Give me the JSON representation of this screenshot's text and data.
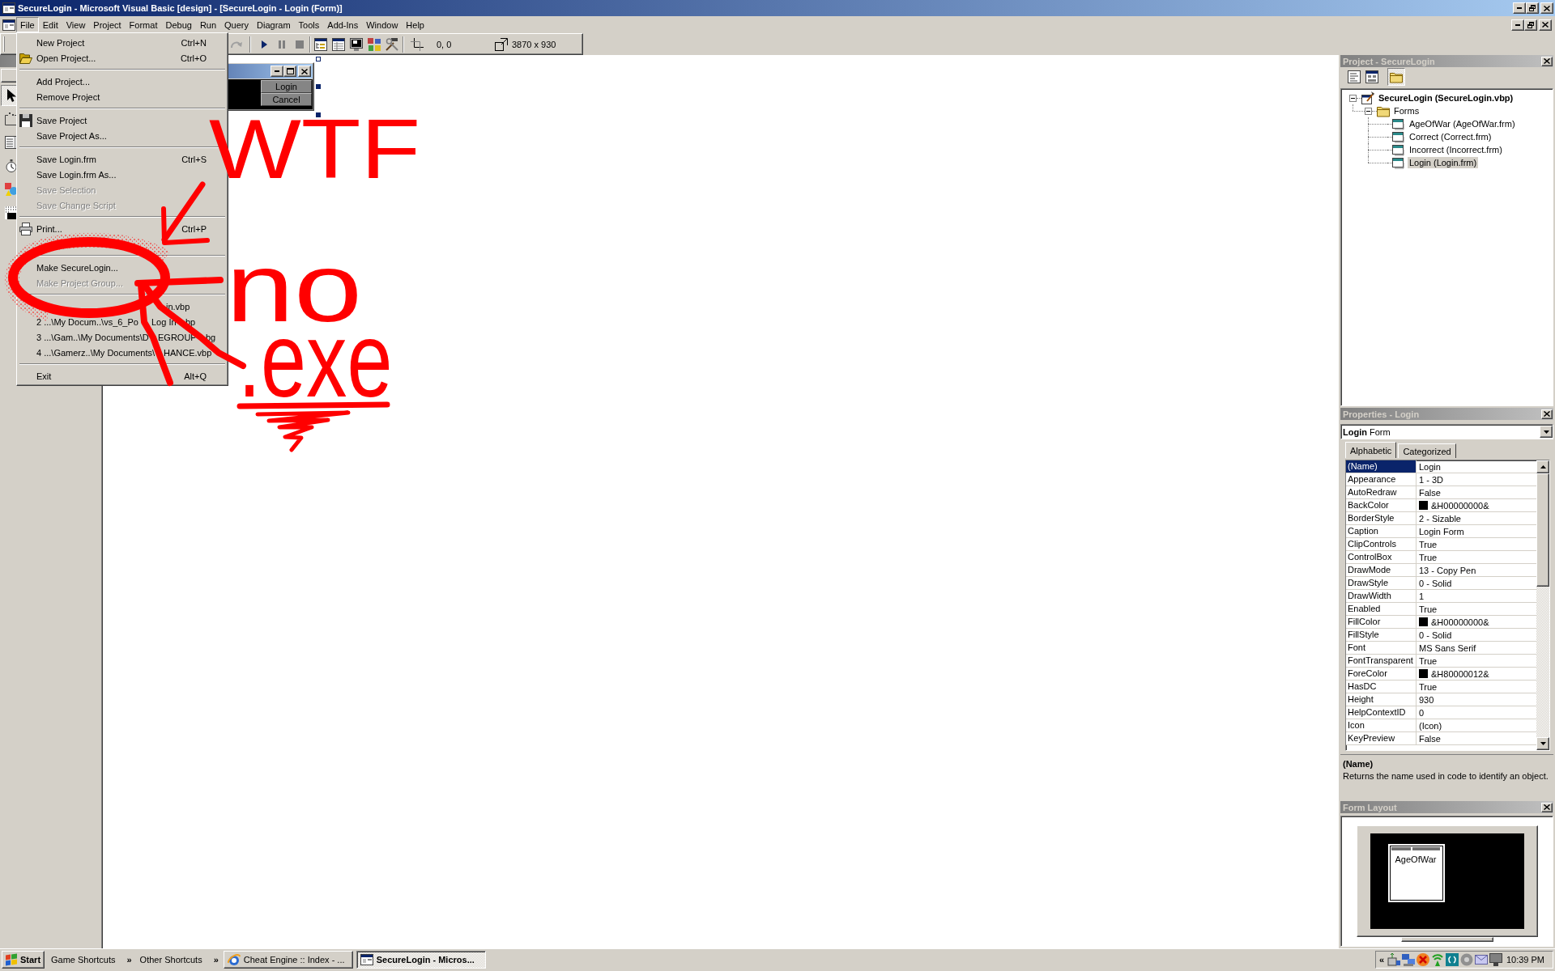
{
  "window": {
    "title": "SecureLogin - Microsoft Visual Basic [design] - [SecureLogin - Login (Form)]"
  },
  "menu_bar": [
    {
      "label": "File",
      "selected": true
    },
    {
      "label": "Edit",
      "selected": false
    },
    {
      "label": "View",
      "selected": false
    },
    {
      "label": "Project",
      "selected": false
    },
    {
      "label": "Format",
      "selected": false
    },
    {
      "label": "Debug",
      "selected": false
    },
    {
      "label": "Run",
      "selected": false
    },
    {
      "label": "Query",
      "selected": false
    },
    {
      "label": "Diagram",
      "selected": false
    },
    {
      "label": "Tools",
      "selected": false
    },
    {
      "label": "Add-Ins",
      "selected": false
    },
    {
      "label": "Window",
      "selected": false
    },
    {
      "label": "Help",
      "selected": false
    }
  ],
  "file_menu": [
    [
      {
        "kind": "command",
        "label": "New Project",
        "shortcut": "Ctrl+N",
        "disabled": false
      },
      {
        "kind": "command",
        "label": "Open Project...",
        "shortcut": "Ctrl+O",
        "icon": true,
        "disabled": false
      }
    ],
    [
      {
        "kind": "command",
        "label": "Add Project...",
        "disabled": false
      },
      {
        "kind": "command",
        "label": "Remove Project",
        "disabled": false
      }
    ],
    [
      {
        "kind": "command",
        "label": "Save Project",
        "icon": true,
        "disabled": false
      },
      {
        "kind": "command",
        "label": "Save Project As...",
        "disabled": false
      }
    ],
    [
      {
        "kind": "command",
        "label": "Save Login.frm",
        "shortcut": "Ctrl+S",
        "disabled": false
      },
      {
        "kind": "command",
        "label": "Save Login.frm As...",
        "disabled": false
      },
      {
        "kind": "command",
        "label": "Save Selection",
        "disabled": true
      },
      {
        "kind": "command",
        "label": "Save Change Script",
        "disabled": true
      }
    ],
    [
      {
        "kind": "command",
        "label": "Print...",
        "shortcut": "Ctrl+P",
        "icon": true,
        "disabled": false
      },
      {
        "kind": "covered"
      }
    ],
    [
      {
        "kind": "command",
        "label": "Make SecureLogin...",
        "disabled": false
      },
      {
        "kind": "command",
        "label": "Make Project Group...",
        "disabled": true
      }
    ],
    [
      {
        "kind": "recent",
        "fragments": [
          "in.vbp"
        ],
        "disabled": false
      },
      {
        "kind": "recent",
        "fragments": [
          "2 ...\\My Docum..\\vs_6_Po",
          "Log In",
          "bp"
        ],
        "disabled": false
      },
      {
        "kind": "recent",
        "fragments": [
          "3 ...\\Gam..\\My Documents\\D",
          "EGROUP",
          "bg"
        ],
        "disabled": false
      },
      {
        "kind": "recent",
        "fragments": [
          "4 ...\\Gamerz..\\My Documents\\",
          "HANCE.vbp"
        ],
        "disabled": false
      }
    ],
    [
      {
        "kind": "command",
        "label": "Exit",
        "shortcut": "Alt+Q",
        "disabled": false
      }
    ]
  ],
  "toolbar": {
    "position": "0, 0",
    "size": "3870 x 930"
  },
  "toolbox": [
    {
      "selected": true
    },
    {
      "selected": false
    },
    {
      "selected": false
    },
    {
      "selected": false
    },
    {
      "selected": false
    },
    {
      "selected": false
    }
  ],
  "designer": {
    "form_buttons": [
      "Login",
      "Cancel"
    ]
  },
  "project": {
    "title": "Project - SecureLogin",
    "toolbar": [
      {
        "on": false
      },
      {
        "on": false
      },
      {
        "on": true
      }
    ],
    "tree": [
      {
        "label": "SecureLogin (SecureLogin.vbp)",
        "selected": false,
        "expanded": true,
        "children": [
          {
            "label": "Forms",
            "selected": false,
            "expanded": true,
            "children": [
              {
                "label": "AgeOfWar (AgeOfWar.frm)",
                "selected": false
              },
              {
                "label": "Correct (Correct.frm)",
                "selected": false
              },
              {
                "label": "Incorrect (Incorrect.frm)",
                "selected": false
              },
              {
                "label": "Login (Login.frm)",
                "selected": true
              }
            ]
          }
        ]
      }
    ]
  },
  "properties": {
    "title": "Properties - Login",
    "object": "**Login** Form",
    "tabs": [
      {
        "label": "Alphabetic",
        "selected": true
      },
      {
        "label": "Categorized",
        "selected": false
      }
    ],
    "rows": [
      {
        "name": "(Name)",
        "value": "Login",
        "selected": true
      },
      {
        "name": "Appearance",
        "value": "1 - 3D",
        "selected": false
      },
      {
        "name": "AutoRedraw",
        "value": "False",
        "selected": false
      },
      {
        "name": "BackColor",
        "value": "&H00000000&",
        "color": "#000000",
        "selected": false
      },
      {
        "name": "BorderStyle",
        "value": "2 - Sizable",
        "selected": false
      },
      {
        "name": "Caption",
        "value": "Login Form",
        "selected": false
      },
      {
        "name": "ClipControls",
        "value": "True",
        "selected": false
      },
      {
        "name": "ControlBox",
        "value": "True",
        "selected": false
      },
      {
        "name": "DrawMode",
        "value": "13 - Copy Pen",
        "selected": false
      },
      {
        "name": "DrawStyle",
        "value": "0 - Solid",
        "selected": false
      },
      {
        "name": "DrawWidth",
        "value": "1",
        "selected": false
      },
      {
        "name": "Enabled",
        "value": "True",
        "selected": false
      },
      {
        "name": "FillColor",
        "value": "&H00000000&",
        "color": "#000000",
        "selected": false
      },
      {
        "name": "FillStyle",
        "value": "0 - Solid",
        "selected": false
      },
      {
        "name": "Font",
        "value": "MS Sans Serif",
        "selected": false
      },
      {
        "name": "FontTransparent",
        "value": "True",
        "selected": false
      },
      {
        "name": "ForeColor",
        "value": "&H80000012&",
        "color": "#000000",
        "selected": false
      },
      {
        "name": "HasDC",
        "value": "True",
        "selected": false
      },
      {
        "name": "Height",
        "value": "930",
        "selected": false
      },
      {
        "name": "HelpContextID",
        "value": "0",
        "selected": false
      },
      {
        "name": "Icon",
        "value": "(Icon)",
        "selected": false
      },
      {
        "name": "KeyPreview",
        "value": "False",
        "selected": false
      }
    ],
    "description": {
      "heading": "(Name)",
      "text": "Returns the name used in code to identify an object."
    }
  },
  "form_layout": {
    "title": "Form Layout",
    "preview_caption": "AgeOfWar"
  },
  "annotations": [
    {
      "text": "WTF"
    },
    {
      "text": "no"
    },
    {
      "text": ".exe"
    }
  ],
  "taskbar": {
    "start": "Start",
    "toolbars": [
      {
        "title": "Game Shortcuts",
        "chevron": "»"
      },
      {
        "title": "Other Shortcuts",
        "chevron": "»"
      }
    ],
    "tasks": [
      {
        "label": "Cheat Engine :: Index - ...",
        "selected": false
      },
      {
        "label": "SecureLogin - Micros...",
        "selected": true
      }
    ],
    "tray": {
      "chevron": "«",
      "time": "10:39 PM"
    }
  }
}
